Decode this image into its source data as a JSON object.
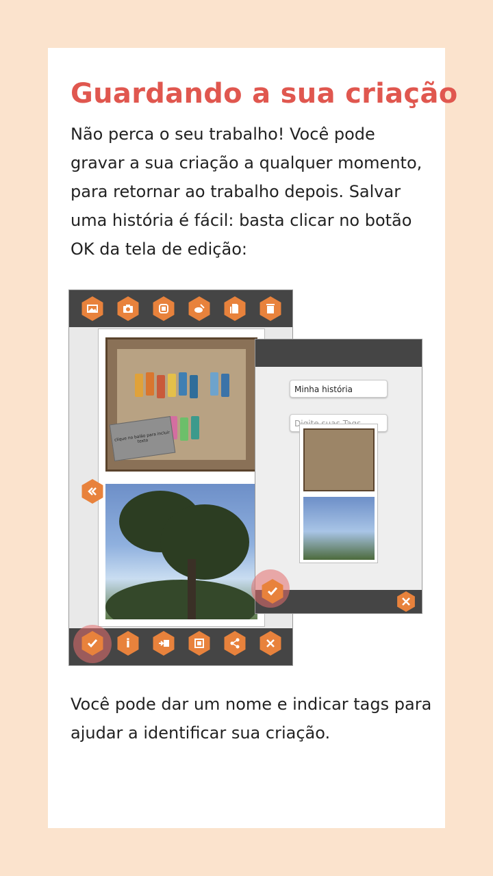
{
  "title": "Guardando a sua criação",
  "intro_text": "Não perca o seu trabalho! Você pode gravar a sua criação a qualquer momento, para retornar ao trabalho depois. Salvar uma história é fácil: basta clicar no botão OK da tela de edição:",
  "closing_text": "Você pode dar um nome e indicar tags para ajudar a identificar sua criação.",
  "colors": {
    "background": "#fbe3cd",
    "card": "#ffffff",
    "title": "#e0574f",
    "accent": "#e8823c",
    "toolbar": "#454545"
  },
  "editor": {
    "top_icons": [
      "image-icon",
      "camera-icon",
      "stop-icon",
      "draw-icon",
      "document-icon",
      "trash-icon"
    ],
    "bottom_icons": [
      "check-icon",
      "info-icon",
      "move-image-icon",
      "fit-screen-icon",
      "share-icon",
      "close-icon"
    ],
    "speech_bubble": "clique no balão para incluir texto",
    "info_glyph": "i"
  },
  "save_panel": {
    "name_value": "Minha história",
    "tags_placeholder": "Digite suas Tags"
  }
}
